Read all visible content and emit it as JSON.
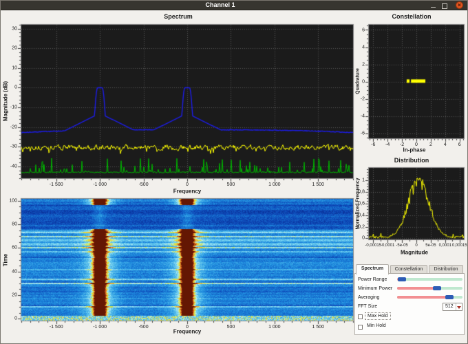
{
  "window": {
    "title": "Channel 1"
  },
  "colors": {
    "titlebar_bg": "#37352f",
    "close_button_orange": "#e0541f",
    "plot_background": "#1b1b1b",
    "grid_dots": "#575757",
    "trace_max_hold_blue": "#1c1ce8",
    "trace_live_yellow": "#ffff00",
    "trace_min_hold_green": "#00b400",
    "slider_fill_pink": "#f28f92",
    "slider_track_green": "#bfe8cf",
    "slider_handle_blue": "#2d5cb5"
  },
  "spectrum": {
    "title": "Spectrum",
    "xlabel": "Frequency",
    "ylabel": "Magnitude (dB)"
  },
  "waterfall": {
    "xlabel": "Frequency",
    "ylabel": "Time"
  },
  "constellation": {
    "title": "Constellation",
    "xlabel": "In-phase",
    "ylabel": "Quadrature"
  },
  "distribution": {
    "title": "Distribution",
    "xlabel": "Magnitude",
    "ylabel": "Normalized Frequency"
  },
  "controls": {
    "tabs": [
      {
        "label": "Spectrum",
        "active": true
      },
      {
        "label": "Constellation",
        "active": false
      },
      {
        "label": "Distribution",
        "active": false
      }
    ],
    "sliders": [
      {
        "label": "Power Range",
        "value": 0.07
      },
      {
        "label": "Minimum Power",
        "value": 0.61
      },
      {
        "label": "Averaging",
        "value": 0.8
      }
    ],
    "fft": {
      "label": "FFT Size",
      "value": "512"
    },
    "checkboxes": [
      {
        "label": "Max Hold",
        "checked": false,
        "focused": true
      },
      {
        "label": "Min Hold",
        "checked": false,
        "focused": false
      }
    ]
  },
  "chart_data": {
    "spectrum": {
      "type": "line",
      "xlim": [
        -1900,
        1900
      ],
      "ylim": [
        -46,
        32
      ],
      "xticks": {
        "values": [
          -1500,
          -1000,
          -500,
          0,
          500,
          1000,
          1500
        ],
        "labels": [
          "-1 500",
          "-1 000",
          "-500",
          "0",
          "500",
          "1 000",
          "1 500"
        ],
        "minor_step": 100
      },
      "yticks": {
        "values": [
          30,
          20,
          10,
          0,
          -10,
          -20,
          -30,
          -40
        ],
        "labels": [
          "30",
          "20",
          "10",
          "0",
          "-10",
          "-20",
          "-30",
          "-40"
        ],
        "minor_step": 2
      },
      "series": [
        {
          "name": "max_hold_trace",
          "color": "#1c1ce8",
          "baseline": -21.4,
          "edge_droop": 1.4,
          "noise": 0.18,
          "seed": 7,
          "peaks": [
            {
              "center": -1000,
              "top_db": 0,
              "flat_halfwidth": 26,
              "core_k": 0.012,
              "skirt_a": 13,
              "skirt_b": 0.022
            },
            {
              "center": 0,
              "top_db": 0,
              "flat_halfwidth": 26,
              "core_k": 0.012,
              "skirt_a": 13,
              "skirt_b": 0.022
            }
          ]
        },
        {
          "name": "live_trace",
          "color": "#ffff00",
          "mean": -30.3,
          "jitter": 2.1,
          "dip_prob": 0.1,
          "dip_depth": 5,
          "seed": 13
        },
        {
          "name": "min_hold_trace",
          "color": "#00b400",
          "baseline": -43.6,
          "spike_prob": 0.3,
          "spike_max": 7.5,
          "seed": 29
        }
      ]
    },
    "waterfall": {
      "type": "heatmap",
      "xlim": [
        -1900,
        1900
      ],
      "ylim": [
        -1.5,
        101.5
      ],
      "xticks": {
        "values": [
          -1500,
          -1000,
          -500,
          0,
          500,
          1000,
          1500
        ],
        "labels": [
          "-1 500",
          "-1 000",
          "-500",
          "0",
          "500",
          "1 000",
          "1 500"
        ],
        "minor_step": 100
      },
      "yticks": {
        "values": [
          0,
          20,
          40,
          60,
          80,
          100
        ],
        "labels": [
          "0",
          "20",
          "40",
          "60",
          "80",
          "100"
        ],
        "minor_step": 5
      },
      "signal_bands": [
        {
          "center": -1000,
          "width": 62
        },
        {
          "center": 0,
          "width": 62
        }
      ],
      "quiet_time_range": [
        76,
        96.5
      ],
      "recent_rows_time": 97,
      "seed": 101
    },
    "constellation": {
      "type": "scatter",
      "xlim": [
        -6.6,
        6.6
      ],
      "ylim": [
        -6.6,
        6.6
      ],
      "xticks": {
        "values": [
          -6,
          -4,
          -2,
          0,
          2,
          4,
          6
        ],
        "labels": [
          "-6",
          "-4",
          "-2",
          "0",
          "2",
          "4",
          "6"
        ],
        "minor_step": 0.5
      },
      "yticks": {
        "values": [
          6,
          4,
          2,
          0,
          -2,
          -4,
          -6
        ],
        "labels": [
          "6",
          "4",
          "2",
          "0",
          "-2",
          "-4",
          "-6"
        ],
        "minor_step": 0.5
      },
      "segments": [
        {
          "x_from": -1.35,
          "x_to": -0.95,
          "y": 0.05
        },
        {
          "x_from": -0.75,
          "x_to": 1.25,
          "y": 0.05
        }
      ],
      "point_color": "#ffff00"
    },
    "distribution": {
      "type": "line",
      "xlim": [
        -0.000165,
        0.000165
      ],
      "ylim": [
        -0.02,
        1.22
      ],
      "xticks": {
        "values": [
          -0.00015,
          -0.0001,
          -5e-05,
          0,
          5e-05,
          0.0001,
          0.00015
        ],
        "labels": [
          "-0,00015",
          "-0,0001",
          "-5e-05",
          "0",
          "5e-05",
          "0,0001",
          "0,00015"
        ],
        "minor_step": 2.5e-05
      },
      "yticks": {
        "values": [
          0,
          0.2,
          0.4,
          0.6,
          0.8,
          1
        ],
        "labels": [
          "0",
          "0,2",
          "0,4",
          "0,6",
          "0,8",
          "1"
        ],
        "minor_step": 0.05
      },
      "color": "#ffff00",
      "sigma": 5e-05,
      "mu": 8e-06,
      "peak": 1.0,
      "noise": 0.3,
      "floor": 0.025,
      "seed": 17
    }
  }
}
